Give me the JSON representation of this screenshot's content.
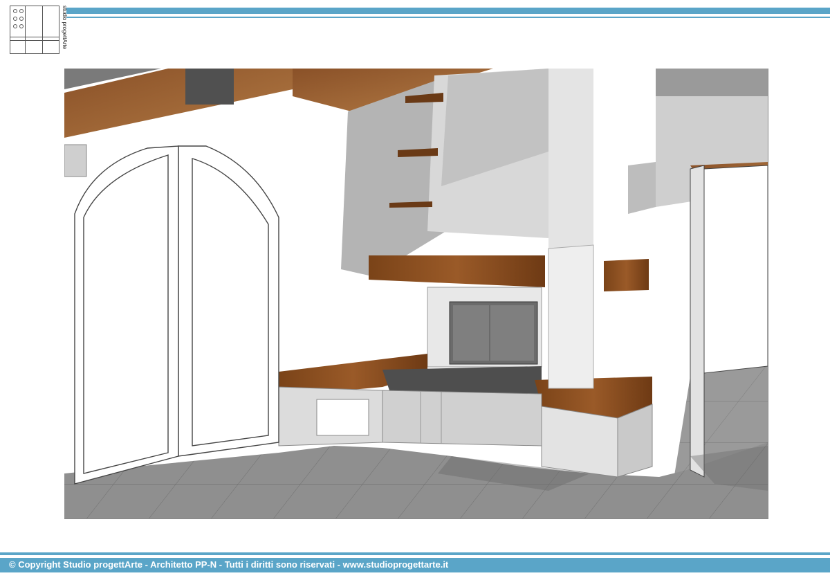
{
  "logo": {
    "vertical_text": "studio progettArte"
  },
  "footer": {
    "copyright": "© Copyright Studio progettArte - Architetto PP-N - Tutti i diritti sono riservati - www.studioprogettarte.it"
  },
  "colors": {
    "accent": "#5aa5c8",
    "wood": "#8a4f22",
    "stone": "#5e5e5e",
    "wall": "#ffffff"
  }
}
